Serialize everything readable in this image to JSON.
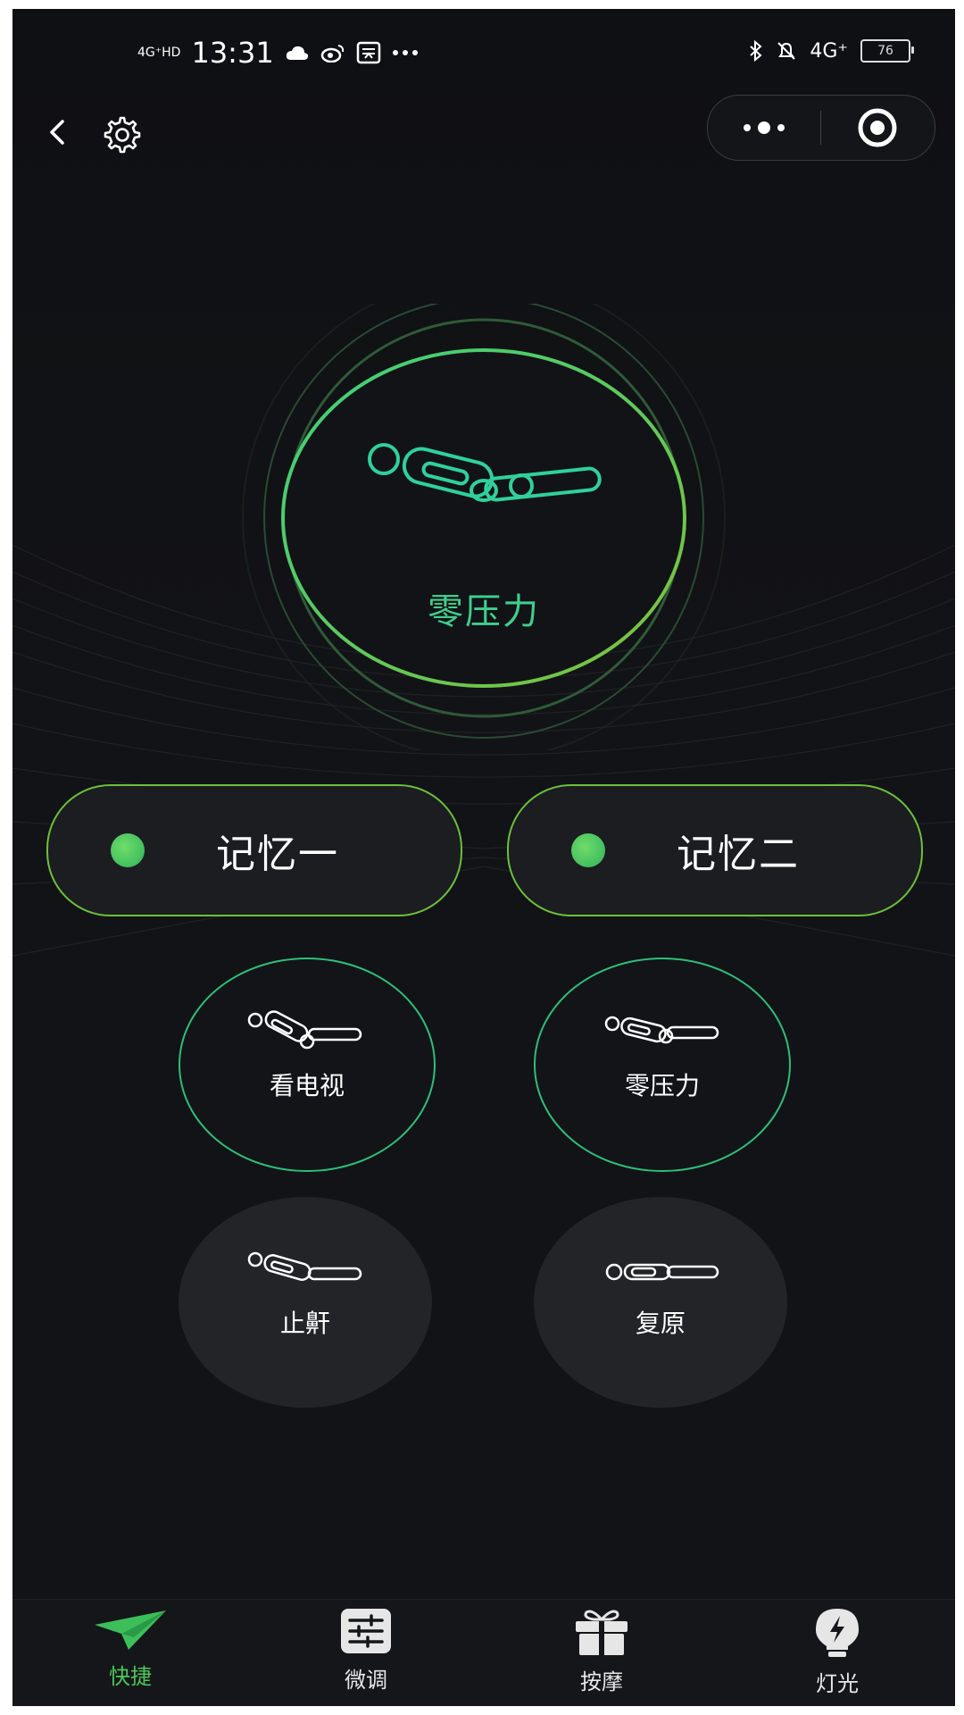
{
  "status_bar": {
    "network": "4G⁺HD",
    "time": "13:31",
    "right_network": "4G⁺",
    "battery": "76"
  },
  "main": {
    "dial_label": "零压力"
  },
  "memory": [
    {
      "label": "记忆一"
    },
    {
      "label": "记忆二"
    }
  ],
  "presets": [
    {
      "label": "看电视"
    },
    {
      "label": "零压力"
    },
    {
      "label": "止鼾"
    },
    {
      "label": "复原"
    }
  ],
  "tabbar": {
    "items": [
      {
        "label": "快捷",
        "icon": "paper-plane-icon"
      },
      {
        "label": "微调",
        "icon": "sliders-icon"
      },
      {
        "label": "按摩",
        "icon": "gift-icon"
      },
      {
        "label": "灯光",
        "icon": "bulb-icon"
      }
    ]
  },
  "colors": {
    "accent_green": "#3fcf8f",
    "memory_border": "#6cc03a",
    "tab_active": "#4ac75a"
  }
}
